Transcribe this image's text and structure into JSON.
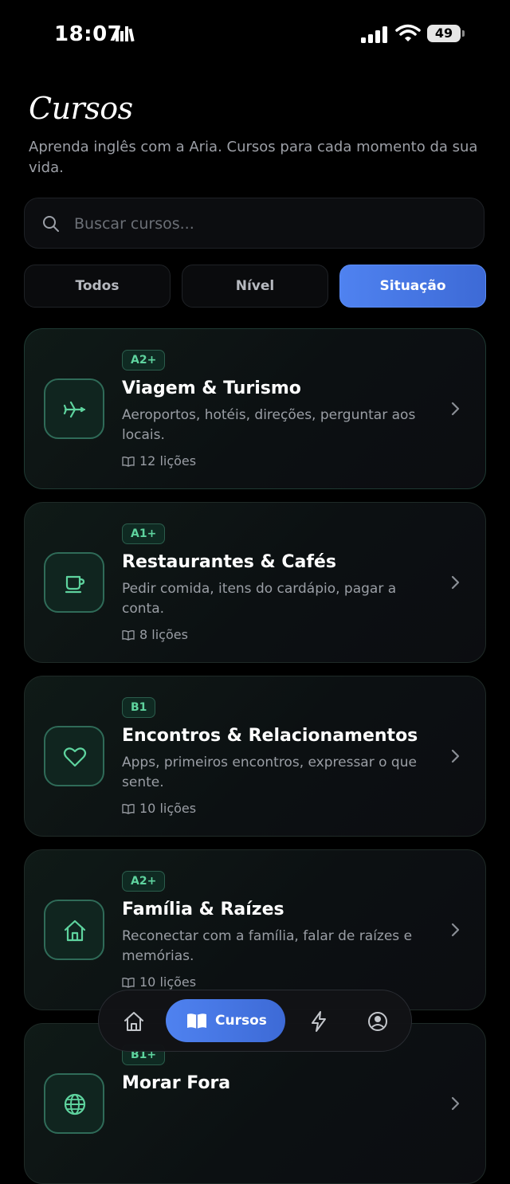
{
  "status": {
    "time": "18:07",
    "battery": "49"
  },
  "header": {
    "title": "Cursos",
    "subtitle": "Aprenda inglês com a Aria. Cursos para cada momento da sua vida."
  },
  "search": {
    "placeholder": "Buscar cursos..."
  },
  "tabs": [
    {
      "label": "Todos",
      "active": false
    },
    {
      "label": "Nível",
      "active": false
    },
    {
      "label": "Situação",
      "active": true
    }
  ],
  "courses": [
    {
      "badge": "A2+",
      "title": "Viagem & Turismo",
      "description": "Aeroportos, hotéis, direções, perguntar aos locais.",
      "lessons": "12 lições",
      "icon": "airplane-icon"
    },
    {
      "badge": "A1+",
      "title": "Restaurantes & Cafés",
      "description": "Pedir comida, itens do cardápio, pagar a conta.",
      "lessons": "8 lições",
      "icon": "coffee-cup-icon"
    },
    {
      "badge": "B1",
      "title": "Encontros & Relacionamentos",
      "description": "Apps, primeiros encontros, expressar o que sente.",
      "lessons": "10 lições",
      "icon": "heart-icon"
    },
    {
      "badge": "A2+",
      "title": "Família & Raízes",
      "description": "Reconectar com a família, falar de raízes e memórias.",
      "lessons": "10 lições",
      "icon": "home-icon"
    },
    {
      "badge": "B1+",
      "title": "Morar Fora",
      "description": "",
      "lessons": "",
      "icon": "globe-icon"
    }
  ],
  "nav": {
    "active_label": "Cursos"
  },
  "colors": {
    "accent": "#4f82f0",
    "green": "#5ed39e",
    "background": "#000000"
  }
}
